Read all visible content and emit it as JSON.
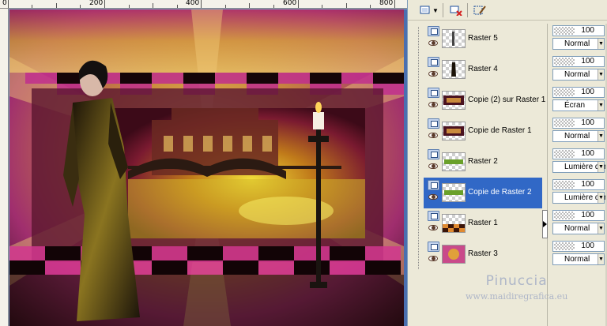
{
  "ruler": {
    "marks": [
      "0",
      "200",
      "400",
      "600",
      "800"
    ]
  },
  "toolbar": {
    "new_layer_icon": "new-raster-layer-icon",
    "delete_icon": "delete-layer-icon",
    "edit_icon": "edit-selection-icon"
  },
  "layers": [
    {
      "name": "Raster 5",
      "opacity": "100",
      "blend": "Normal",
      "thumb": "tiny-figure"
    },
    {
      "name": "Raster 4",
      "opacity": "100",
      "blend": "Normal",
      "thumb": "woman-figure"
    },
    {
      "name": "Copie (2) sur Raster 1",
      "opacity": "100",
      "blend": "Écran",
      "thumb": "dark-frame"
    },
    {
      "name": "Copie de Raster 1",
      "opacity": "100",
      "blend": "Normal",
      "thumb": "dark-frame"
    },
    {
      "name": "Raster 2",
      "opacity": "100",
      "blend": "Lumière dure",
      "thumb": "green-bridge"
    },
    {
      "name": "Copie de Raster 2",
      "opacity": "100",
      "blend": "Lumière dure",
      "thumb": "green-bridge",
      "selected": true
    },
    {
      "name": "Raster 1",
      "opacity": "100",
      "blend": "Normal",
      "thumb": "checker-floor"
    },
    {
      "name": "Raster 3",
      "opacity": "100",
      "blend": "Normal",
      "thumb": "pink-gold"
    }
  ],
  "watermark": {
    "name": "Pinuccia",
    "url": "www.maidiregrafica.eu"
  },
  "colors": {
    "selection": "#3168c6",
    "panel": "#ece9d8",
    "workspace": "#7b9bc9"
  }
}
